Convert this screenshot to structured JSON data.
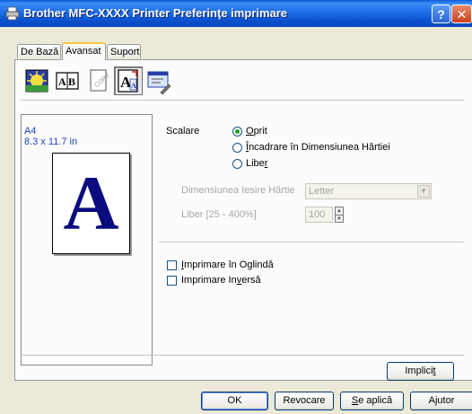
{
  "window": {
    "title": "Brother MFC-XXXX Printer Preferinţe imprimare",
    "help_label": "?",
    "close_label": "✕"
  },
  "tabs": [
    {
      "label": "De Bază",
      "active": false
    },
    {
      "label": "Avansat",
      "active": true
    },
    {
      "label": "Suport",
      "active": false
    }
  ],
  "toolbar": {
    "icons": [
      "color-quality-icon",
      "duplex-ab-icon",
      "watermark-copy-icon",
      "page-scaling-icon",
      "other-settings-icon"
    ],
    "active_index": 3
  },
  "preview": {
    "paper_name": "A4",
    "paper_dims": "8.3 x 11.7 in",
    "sample_letter": "A"
  },
  "scaling": {
    "label": "Scalare",
    "options": [
      {
        "label_prefix": "",
        "label_underline": "O",
        "label_suffix": "prit",
        "selected": true
      },
      {
        "label_prefix": "",
        "label_underline": "Î",
        "label_suffix": "ncadrare în Dimensiunea Hârtiei",
        "selected": false
      },
      {
        "label_prefix": "Libe",
        "label_underline": "r",
        "label_suffix": "",
        "selected": false
      }
    ],
    "output_paper_label": "Dimensiunea Iesire Hârtie",
    "output_paper_value": "Letter",
    "free_range_label": "Liber [25 - 400%]",
    "free_value": "100"
  },
  "print_options": [
    {
      "label_prefix": "",
      "label_underline": "I",
      "label_suffix": "mprimare în Oglindă",
      "checked": false
    },
    {
      "label_prefix": "Imprimare In",
      "label_underline": "v",
      "label_suffix": "ersă",
      "checked": false
    }
  ],
  "buttons": {
    "default": {
      "prefix": "Implici",
      "underline": "t",
      "suffix": ""
    },
    "ok": "OK",
    "cancel": "Revocare",
    "apply": {
      "prefix": "",
      "underline": "S",
      "suffix": "e aplică"
    },
    "help": "Ajutor"
  },
  "colors": {
    "titlebar": "#0a5bd6",
    "preview_letter": "#0b0b80",
    "paper_label": "#1e3fbf",
    "dialog_bg": "#ece9d8"
  }
}
